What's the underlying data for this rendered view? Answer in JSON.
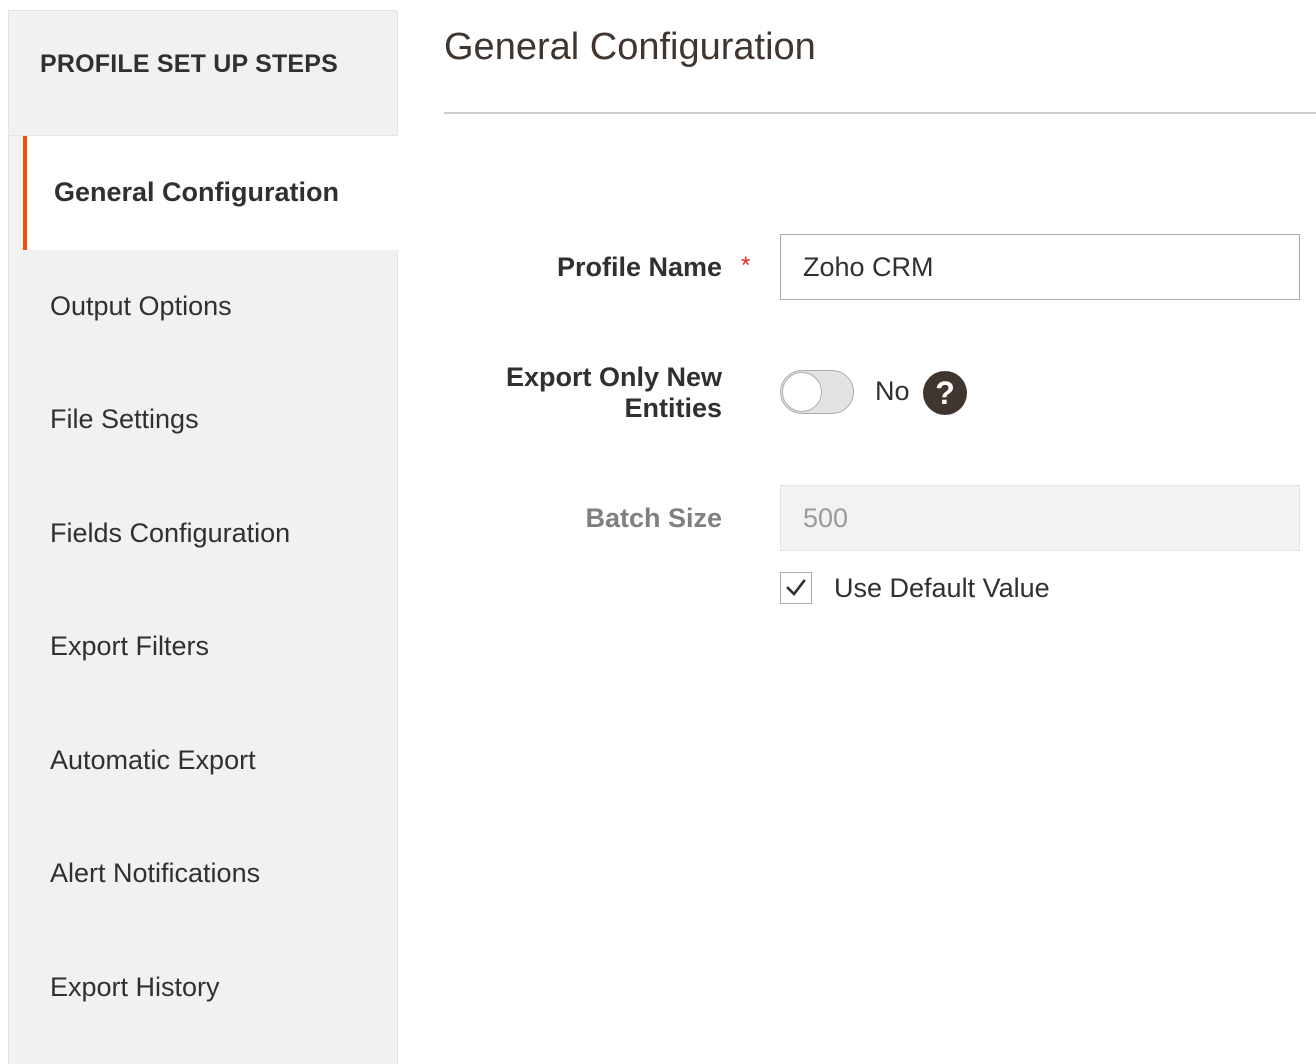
{
  "sidebar": {
    "title": "PROFILE SET UP STEPS",
    "items": [
      {
        "label": "General Configuration",
        "active": true
      },
      {
        "label": "Output Options"
      },
      {
        "label": "File Settings"
      },
      {
        "label": "Fields Configuration"
      },
      {
        "label": "Export Filters"
      },
      {
        "label": "Automatic Export"
      },
      {
        "label": "Alert Notifications"
      },
      {
        "label": "Export History"
      }
    ]
  },
  "main": {
    "title": "General Configuration",
    "profile_name": {
      "label": "Profile Name",
      "required_mark": "*",
      "value": "Zoho CRM"
    },
    "export_only_new": {
      "label_line1": "Export Only New",
      "label_line2": "Entities",
      "state_text": "No",
      "help_glyph": "?"
    },
    "batch_size": {
      "label": "Batch Size",
      "value": "500",
      "use_default_label": "Use Default Value",
      "use_default_checked": true
    }
  },
  "colors": {
    "accent": "#eb5202",
    "required": "#e22626",
    "sidebar_bg": "#f1f1f1",
    "help_icon_bg": "#41362f"
  },
  "icons": {
    "help": "question-circle-icon",
    "check": "checkmark-icon"
  }
}
